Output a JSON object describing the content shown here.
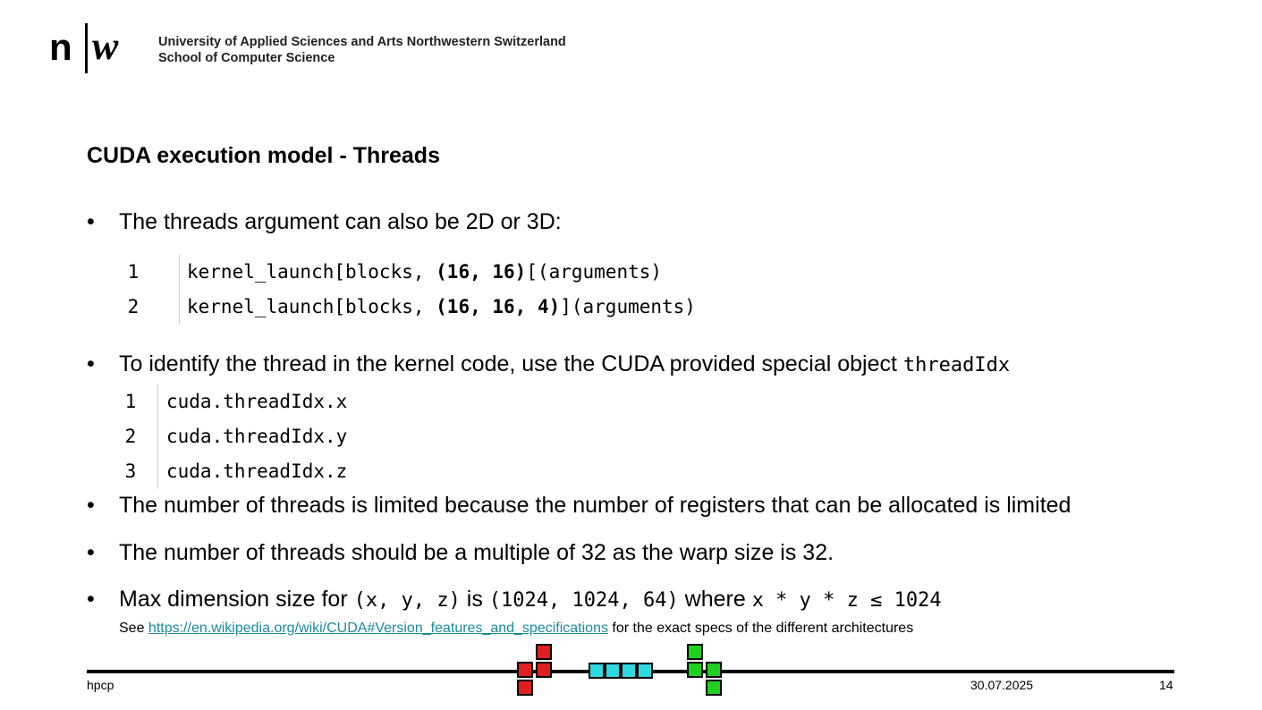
{
  "header": {
    "logo_n": "n",
    "logo_w": "w",
    "org_line1": "University of Applied Sciences and Arts Northwestern Switzerland",
    "org_line2": "School of Computer Science"
  },
  "slide": {
    "title": "CUDA execution model - Threads",
    "bullet1": "The threads argument can also be 2D or 3D:",
    "code1": [
      {
        "ln": "1",
        "pre": "kernel_launch[blocks, ",
        "bold": "(16, 16)",
        "post": "[(arguments)"
      },
      {
        "ln": "2",
        "pre": "kernel_launch[blocks, ",
        "bold": "(16, 16, 4)",
        "post": "](arguments)"
      }
    ],
    "bullet2_text": "To identify the thread in the kernel code, use the CUDA provided special object ",
    "bullet2_code": "threadIdx",
    "code2": [
      {
        "ln": "1",
        "text": "cuda.threadIdx.x"
      },
      {
        "ln": "2",
        "text": "cuda.threadIdx.y"
      },
      {
        "ln": "3",
        "text": "cuda.threadIdx.z"
      }
    ],
    "bullet3": "The number of threads is limited because the number of registers that can be allocated is limited",
    "bullet4": "The number of threads should be a multiple of 32 as the warp size is 32.",
    "bullet5": {
      "t1": "Max dimension size for ",
      "c1": "(x, y, z)",
      "t2": " is ",
      "c2": "(1024, 1024, 64)",
      "t3": " where ",
      "c3": "x * y * z ≤ 1024"
    },
    "note": {
      "pre": "See ",
      "link": "https://en.wikipedia.org/wiki/CUDA#Version_features_and_specifications",
      "post": " for the exact specs of the different architectures"
    }
  },
  "footer": {
    "left": "hpcp",
    "date": "30.07.2025",
    "page": "14"
  },
  "colors": {
    "link": "#1a8a9a",
    "tetris_red": "#e02020",
    "tetris_cyan": "#30d8e0",
    "tetris_green": "#20d020"
  }
}
